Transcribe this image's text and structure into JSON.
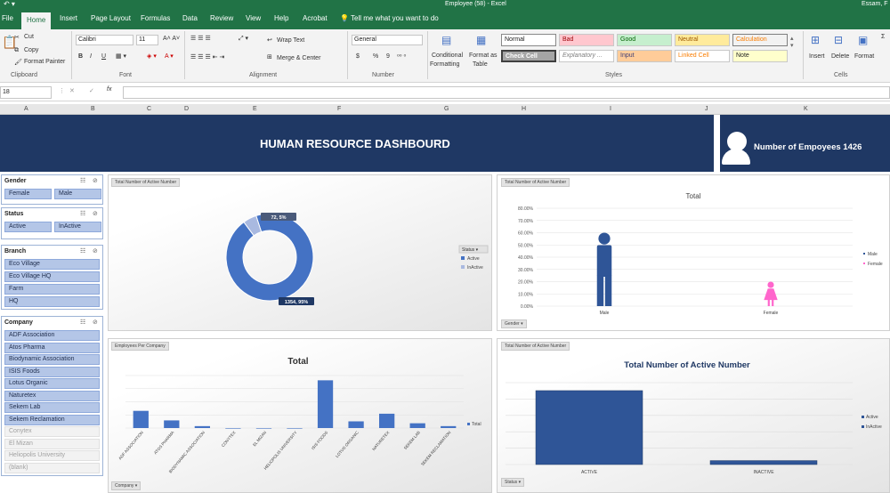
{
  "window": {
    "title": "Employee (58)  -  Excel",
    "user": "Essam, F"
  },
  "tabs": [
    "File",
    "Home",
    "Insert",
    "Page Layout",
    "Formulas",
    "Data",
    "Review",
    "View",
    "Help",
    "Acrobat",
    "Tell me what you want to do"
  ],
  "ribbon": {
    "clipboard": {
      "cut": "Cut",
      "copy": "Copy",
      "format_painter": "Format Painter",
      "label": "Clipboard"
    },
    "font": {
      "name": "Calibri",
      "size": "11",
      "label": "Font",
      "bold": "B",
      "italic": "I",
      "underline": "U"
    },
    "alignment": {
      "wrap": "Wrap Text",
      "merge": "Merge & Center",
      "label": "Alignment"
    },
    "number": {
      "format": "General",
      "currency": "$",
      "percent": "%",
      "comma": "9",
      "label": "Number"
    },
    "styles": {
      "conditional_1": "Conditional",
      "conditional_2": "Formatting",
      "format_table_1": "Format as",
      "format_table_2": "Table",
      "normal": "Normal",
      "bad": "Bad",
      "good": "Good",
      "neutral": "Neutral",
      "calculation": "Calculation",
      "check_cell": "Check Cell",
      "explanatory": "Explanatory ...",
      "input": "Input",
      "linked_cell": "Linked Cell",
      "note": "Note",
      "label": "Styles"
    },
    "cells": {
      "insert": "Insert",
      "delete": "Delete",
      "format": "Format",
      "label": "Cells"
    }
  },
  "formula_bar": {
    "name_box": "18",
    "fx": "fx",
    "cancel": "✕",
    "enter": "✓"
  },
  "columns": [
    "A",
    "B",
    "C",
    "D",
    "E",
    "F",
    "G",
    "H",
    "I",
    "J",
    "K"
  ],
  "dashboard": {
    "title": "HUMAN RESOURCE DASHBOURD",
    "employee_count": "Number of Empoyees 1426"
  },
  "slicers": {
    "gender": {
      "title": "Gender",
      "items": [
        "Female",
        "Male"
      ]
    },
    "status": {
      "title": "Status",
      "items": [
        "Active",
        "InActive"
      ]
    },
    "branch": {
      "title": "Branch",
      "items": [
        "Eco Village",
        "Eco Village HQ",
        "Farm",
        "HQ"
      ]
    },
    "company": {
      "title": "Company",
      "items": [
        {
          "label": "ADF Association",
          "on": true
        },
        {
          "label": "Atos Pharma",
          "on": true
        },
        {
          "label": "Biodynamic Association",
          "on": true
        },
        {
          "label": "ISIS Foods",
          "on": true
        },
        {
          "label": "Lotus Organic",
          "on": true
        },
        {
          "label": "Naturetex",
          "on": true
        },
        {
          "label": "Sekem Lab",
          "on": true
        },
        {
          "label": "Sekem Reclamation",
          "on": true
        },
        {
          "label": "Conytex",
          "on": false
        },
        {
          "label": "El Mizan",
          "on": false
        },
        {
          "label": "Heliopolis University",
          "on": false
        },
        {
          "label": "(blank)",
          "on": false
        }
      ]
    }
  },
  "chart_data": [
    {
      "type": "pie",
      "field_tag": "Total Number  of Active Number",
      "slices": [
        {
          "name": "Active",
          "value": 1354,
          "label": "1354, 95%"
        },
        {
          "name": "InActive",
          "value": 72,
          "label": "72, 5%"
        }
      ],
      "legend_title": "Status",
      "legend": [
        "Active",
        "InActive"
      ],
      "legend_position": "right",
      "colors": [
        "#4472c4",
        "#a9b9e0"
      ]
    },
    {
      "type": "bar",
      "field_tag": "Total Number  of Active Number",
      "title": "Total",
      "categories": [
        "Male",
        "Female"
      ],
      "series": [
        {
          "name": "Male",
          "values": [
            0.6
          ]
        },
        {
          "name": "Female",
          "values": [
            0.2
          ]
        }
      ],
      "ylim": [
        0,
        0.8
      ],
      "y_ticks": [
        "0.00%",
        "10.00%",
        "20.00%",
        "30.00%",
        "40.00%",
        "50.00%",
        "60.00%",
        "70.00%",
        "80.00%"
      ],
      "legend": [
        "Male",
        "Female"
      ],
      "filter_tag": "Gender",
      "colors": [
        "#2f5597",
        "#ff66cc"
      ]
    },
    {
      "type": "bar",
      "field_tag": "Employees  Per  Company",
      "title": "Total",
      "categories": [
        "ADF ASSOCIATION",
        "ATOS PHARMA",
        "BIODYNAMIC ASSOCIATION",
        "CONYTEX",
        "EL MIZAN",
        "HELIOPOLIS UNIVERSITY",
        "ISIS FOODS",
        "LOTUS ORGANIC",
        "NATURETEX",
        "SEKEM LAB",
        "SEKEM RECLAMATION"
      ],
      "values": [
        18,
        8,
        2,
        0,
        0,
        0,
        50,
        7,
        15,
        5,
        2
      ],
      "ylim": [
        0,
        55
      ],
      "legend": [
        "Total"
      ],
      "filter_tag": "Company",
      "color": "#4472c4"
    },
    {
      "type": "bar",
      "field_tag": "Total Number  of Active Number",
      "title": "Total Number of Active Number",
      "categories": [
        "ACTIVE",
        "INACTIVE"
      ],
      "values": [
        1354,
        72
      ],
      "ylim": [
        0,
        1500
      ],
      "legend": [
        "Active",
        "InActive"
      ],
      "filter_tag": "Status",
      "colors": [
        "#2f5597",
        "#2f5597"
      ]
    }
  ]
}
